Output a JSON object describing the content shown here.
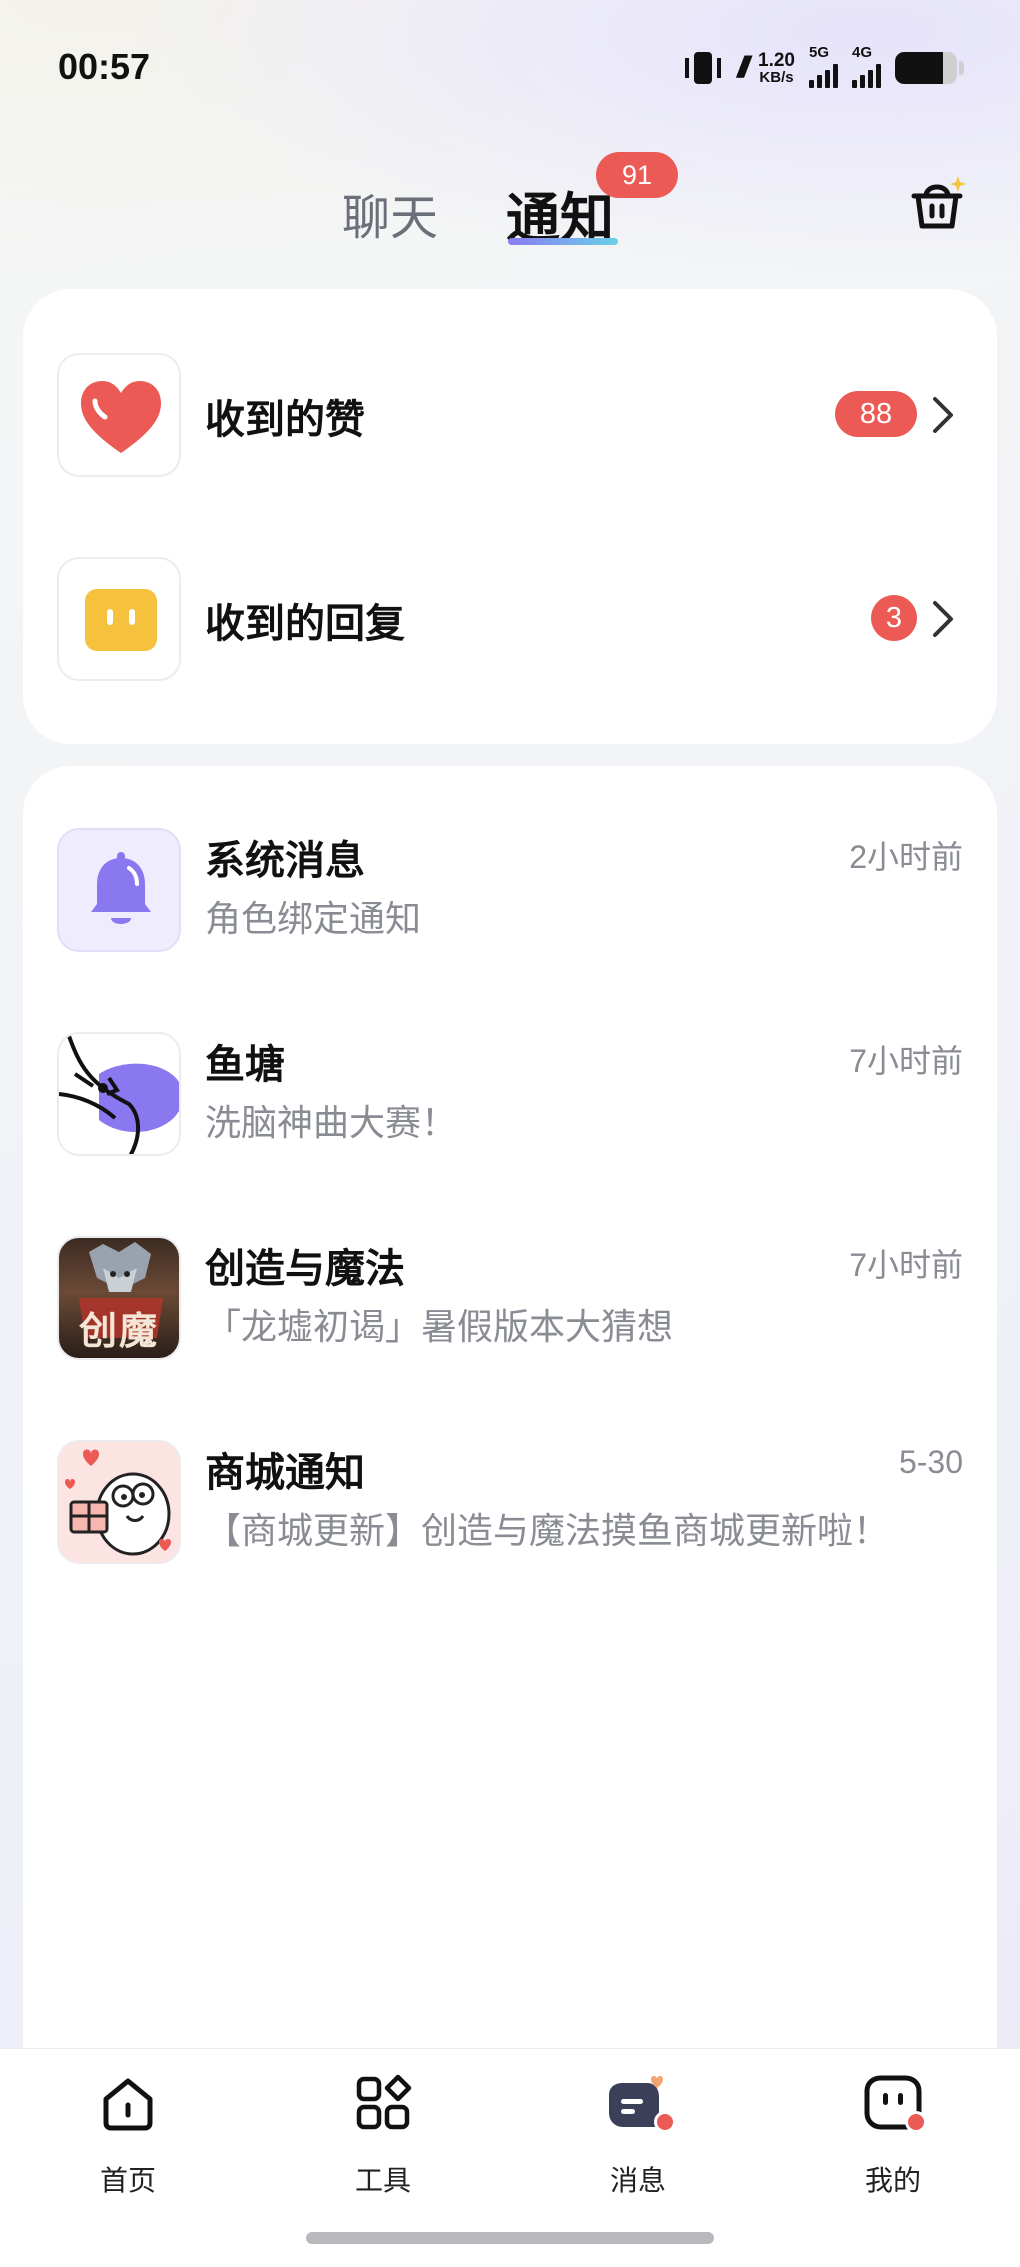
{
  "status_bar": {
    "time": "00:57",
    "speed_value": "1.20",
    "speed_unit": "KB/s",
    "signal1_tag": "5G",
    "signal2_tag": "4G",
    "battery_level": 0.78
  },
  "top_tabs": {
    "chat_label": "聊天",
    "notify_label": "通知",
    "notify_badge": "91"
  },
  "summary": [
    {
      "title": "收到的赞",
      "count": "88",
      "icon": "heart-icon"
    },
    {
      "title": "收到的回复",
      "count": "3",
      "icon": "reply-icon"
    }
  ],
  "messages": [
    {
      "title": "系统消息",
      "subtitle": "角色绑定通知",
      "time": "2小时前",
      "icon": "bell-icon"
    },
    {
      "title": "鱼塘",
      "subtitle": "洗脑神曲大赛！",
      "time": "7小时前",
      "icon": "fish-icon"
    },
    {
      "title": "创造与魔法",
      "subtitle": "「龙墟初谒」暑假版本大猜想",
      "time": "7小时前",
      "icon": "game-logo-icon",
      "logo_text": "创魔"
    },
    {
      "title": "商城通知",
      "subtitle": "【商城更新】创造与魔法摸鱼商城更新啦！",
      "time": "5-30",
      "icon": "mascot-icon"
    }
  ],
  "bottom_nav": [
    {
      "label": "首页",
      "icon": "home-icon"
    },
    {
      "label": "工具",
      "icon": "tools-icon"
    },
    {
      "label": "消息",
      "icon": "message-icon"
    },
    {
      "label": "我的",
      "icon": "profile-icon"
    }
  ],
  "colors": {
    "accent_red": "#ec5a55",
    "tab_gradient_start": "#8a7cf4",
    "tab_gradient_end": "#6ad0e6",
    "bell_purple": "#8a78f0",
    "reply_yellow": "#f6c23e"
  }
}
